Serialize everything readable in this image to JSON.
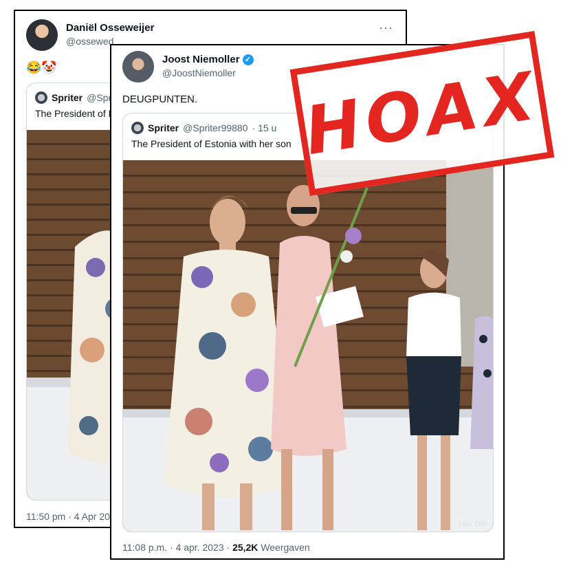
{
  "back_tweet": {
    "author_name": "Daniël Osseweijer",
    "author_handle": "@ossewed",
    "more_label": "···",
    "body": "😂🤡",
    "quote": {
      "name": "Spriter",
      "handle": "@Spri",
      "text": "The President of E"
    },
    "timestamp": "11:50 pm · 4 Apr 20"
  },
  "front_tweet": {
    "author_name": "Joost Niemoller",
    "verified_mark": "✓",
    "author_handle": "@JoostNiemoller",
    "body": "DEUGPUNTEN.",
    "quote": {
      "name": "Spriter",
      "handle": "@Spriter99880",
      "time": "· 15 u",
      "text": "The President of Estonia with her son",
      "watermark": "Foto: ERR"
    },
    "timestamp": "11:08 p.m. · 4 apr. 2023 ·",
    "views_count": "25,2K",
    "views_label": "Weergaven"
  },
  "stamp": {
    "label": "HOAX",
    "color": "#e3261f"
  },
  "colors": {
    "verified": "#1d9bf0",
    "muted": "#536471",
    "border": "#cfd9de"
  }
}
